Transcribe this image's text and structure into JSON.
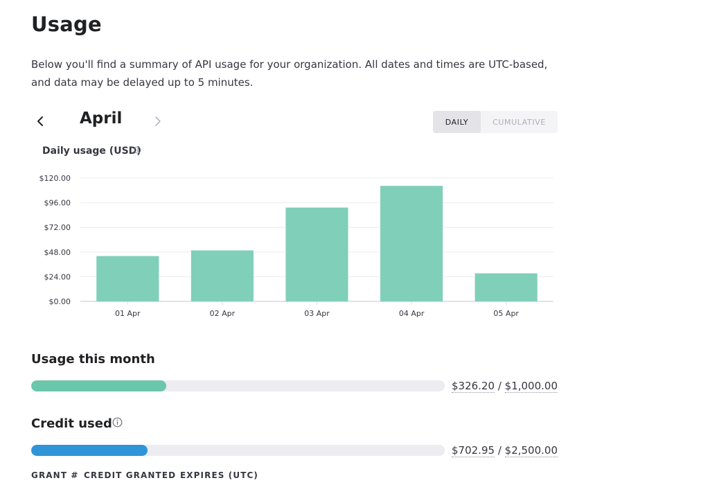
{
  "page": {
    "title": "Usage",
    "description": "Below you'll find a summary of API usage for your organization. All dates and times are UTC-based, and data may be delayed up to 5 minutes."
  },
  "period": {
    "month": "April",
    "tabs": {
      "daily": "DAILY",
      "cumulative": "CUMULATIVE"
    },
    "selected_tab": "DAILY"
  },
  "chart_title": "Daily usage (USD)",
  "chart_data": {
    "type": "bar",
    "title": "Daily usage (USD)",
    "categories": [
      "01 Apr",
      "02 Apr",
      "03 Apr",
      "04 Apr",
      "05 Apr"
    ],
    "values": [
      44.1,
      49.6,
      91.3,
      112.4,
      27.3
    ],
    "y_ticks": [
      "$0.00",
      "$24.00",
      "$48.00",
      "$72.00",
      "$96.00",
      "$120.00"
    ],
    "y_tick_values": [
      0,
      24,
      48,
      72,
      96,
      120
    ],
    "ylim": [
      0,
      120
    ],
    "grid": true,
    "bar_color": "#80cfb9"
  },
  "usage_month": {
    "label": "Usage this month",
    "used": "$326.20",
    "separator": "/",
    "limit": "$1,000.00",
    "fraction": 0.3262,
    "color": "#6bc7a9"
  },
  "credit": {
    "label": "Credit used",
    "used": "$702.95",
    "separator": "/",
    "total": "$2,500.00",
    "fraction": 0.2812,
    "color": "#2f94d8"
  },
  "grants_table": {
    "columns": [
      "GRANT #",
      "CREDIT GRANTED",
      "EXPIRES (UTC)"
    ]
  }
}
